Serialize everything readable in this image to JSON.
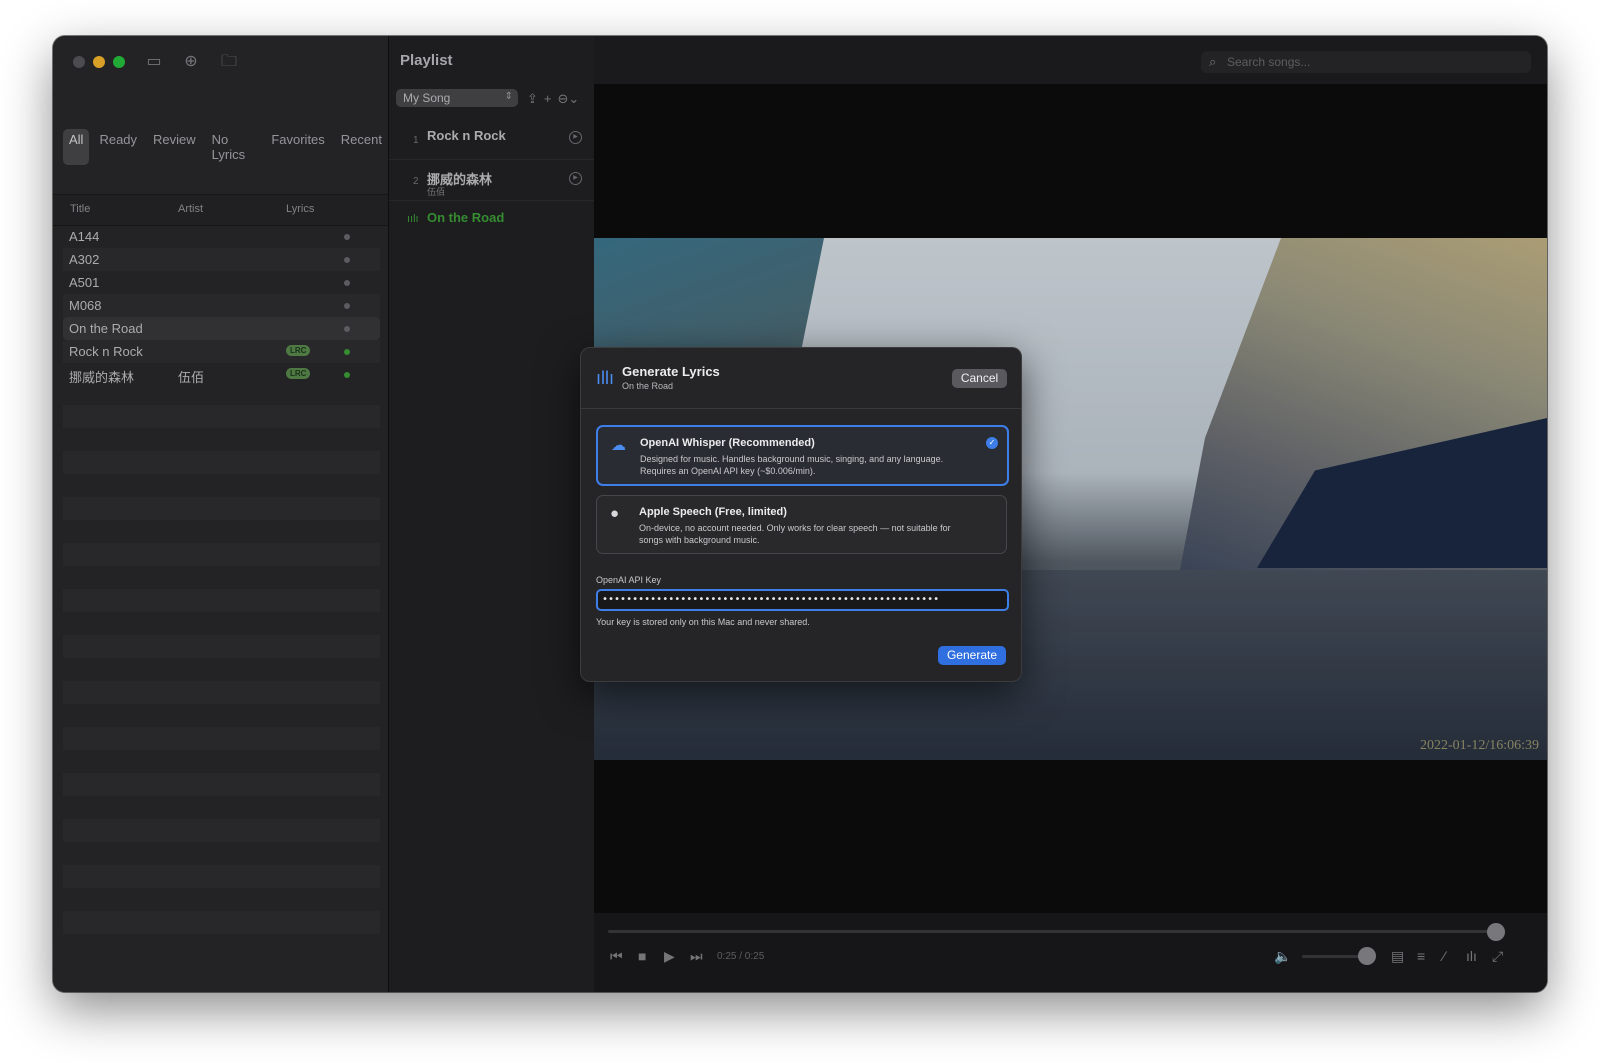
{
  "sidebar": {
    "filters": [
      "All",
      "Ready",
      "Review",
      "No Lyrics",
      "Favorites",
      "Recent"
    ],
    "active_filter": "All",
    "columns": {
      "title": "Title",
      "artist": "Artist",
      "lyrics": "Lyrics"
    },
    "songs": [
      {
        "title": "A144",
        "artist": "",
        "lrc": ""
      },
      {
        "title": "A302",
        "artist": "",
        "lrc": ""
      },
      {
        "title": "A501",
        "artist": "",
        "lrc": ""
      },
      {
        "title": "M068",
        "artist": "",
        "lrc": ""
      },
      {
        "title": "On the Road",
        "artist": "",
        "lrc": ""
      },
      {
        "title": "Rock n Rock",
        "artist": "",
        "lrc": "LRC"
      },
      {
        "title": "挪威的森林",
        "artist": "伍佰",
        "lrc": "LRC"
      }
    ]
  },
  "playlist": {
    "title": "Playlist",
    "selected_playlist": "My Song",
    "items": [
      {
        "num": "1",
        "name": "Rock n Rock",
        "sub": ""
      },
      {
        "num": "2",
        "name": "挪威的森林",
        "sub": "伍佰"
      },
      {
        "num": "",
        "name": "On the Road",
        "sub": ""
      }
    ]
  },
  "search": {
    "placeholder": "Search songs..."
  },
  "video": {
    "timestamp": "2022-01-12/16:06:39"
  },
  "player": {
    "time": "0:25 / 0:25",
    "progress": 1.0,
    "volume": 1.0
  },
  "dialog": {
    "title": "Generate Lyrics",
    "subtitle": "On the Road",
    "cancel": "Cancel",
    "option1": {
      "title": "OpenAI Whisper (Recommended)",
      "desc": "Designed for music. Handles background music, singing, and any language. Requires an OpenAI API key (~$0.006/min)."
    },
    "option2": {
      "title": "Apple Speech (Free, limited)",
      "desc": "On-device, no account needed. Only works for clear speech — not suitable for songs with background music."
    },
    "key_label": "OpenAI API Key",
    "key_value": "••••••••••••••••••••••••••••••••••••••••••••••••••••••••",
    "key_hint": "Your key is stored only on this Mac and never shared.",
    "generate": "Generate"
  },
  "colors": {
    "accent": "#3d7ee8",
    "lrc_badge": "#5c8f4f",
    "playing": "#3fa53a",
    "traffic_red": "#ff5f57",
    "traffic_yellow": "#febc2e",
    "traffic_green": "#28c840"
  }
}
